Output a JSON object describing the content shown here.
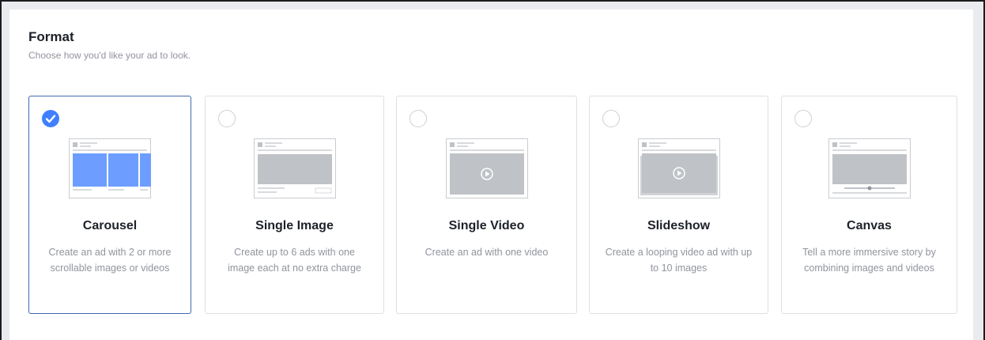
{
  "format": {
    "title": "Format",
    "subtitle": "Choose how you'd like your ad to look."
  },
  "colors": {
    "accent": "#4080ff",
    "selected_border": "#4267b2",
    "mock_gray": "#bfc2c6",
    "mock_blue": "#6d9eff"
  },
  "cards": [
    {
      "title": "Carousel",
      "description": "Create an ad with 2 or more scrollable images or videos",
      "selected": true,
      "icon": "carousel-icon"
    },
    {
      "title": "Single Image",
      "description": "Create up to 6 ads with one image each at no extra charge",
      "selected": false,
      "icon": "single-image-icon"
    },
    {
      "title": "Single Video",
      "description": "Create an ad with one video",
      "selected": false,
      "icon": "single-video-icon"
    },
    {
      "title": "Slideshow",
      "description": "Create a looping video ad with up to 10 images",
      "selected": false,
      "icon": "slideshow-icon"
    },
    {
      "title": "Canvas",
      "description": "Tell a more immersive story by combining images and videos",
      "selected": false,
      "icon": "canvas-icon"
    }
  ]
}
